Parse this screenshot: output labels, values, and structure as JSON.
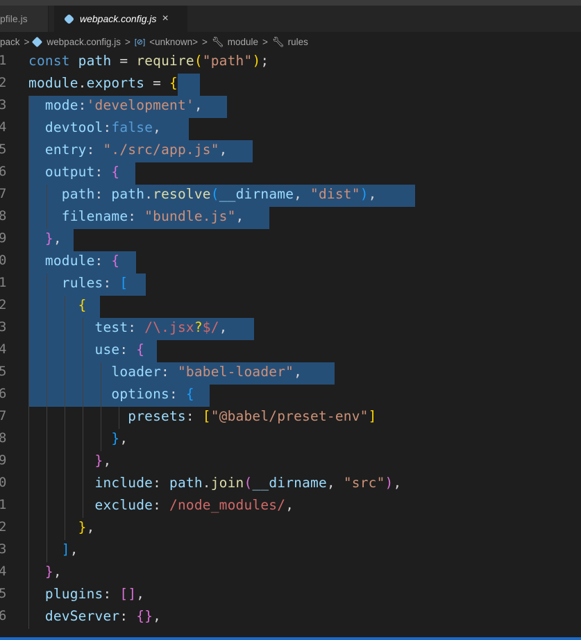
{
  "tabs": [
    {
      "label": "pfile.js",
      "active": false
    },
    {
      "label": "webpack.config.js",
      "active": true,
      "close": "×"
    }
  ],
  "breadcrumb": {
    "folder": "pack",
    "file": "webpack.config.js",
    "unknown_icon": "[⊘]",
    "unknown": "<unknown>",
    "module": "module",
    "rules": "rules",
    "sep": ">"
  },
  "editor": {
    "line_numbers": [
      "1",
      "2",
      "3",
      "4",
      "5",
      "6",
      "7",
      "8",
      "9",
      "0",
      "1",
      "2",
      "3",
      "4",
      "5",
      "6",
      "7",
      "8",
      "9",
      "0",
      "1",
      "2",
      "3",
      "4",
      "5",
      "6"
    ],
    "lines": [
      [
        [
          "kw",
          "const"
        ],
        [
          "p",
          " "
        ],
        [
          "var",
          "path"
        ],
        [
          "p",
          " = "
        ],
        [
          "fn",
          "require"
        ],
        [
          "b1",
          "("
        ],
        [
          "str",
          "\"path\""
        ],
        [
          "b1",
          ")"
        ],
        [
          "p",
          ";"
        ]
      ],
      [
        [
          "var",
          "module"
        ],
        [
          "p",
          "."
        ],
        [
          "var",
          "exports"
        ],
        [
          "p",
          " = "
        ],
        [
          "b1",
          "{"
        ]
      ],
      [
        [
          "p",
          "  "
        ],
        [
          "var",
          "mode"
        ],
        [
          "p",
          ":"
        ],
        [
          "str",
          "'development'"
        ],
        [
          "p",
          ","
        ]
      ],
      [
        [
          "p",
          "  "
        ],
        [
          "var",
          "devtool"
        ],
        [
          "p",
          ":"
        ],
        [
          "kw",
          "false"
        ],
        [
          "p",
          ","
        ]
      ],
      [
        [
          "p",
          "  "
        ],
        [
          "var",
          "entry"
        ],
        [
          "p",
          ": "
        ],
        [
          "str",
          "\"./src/app.js\""
        ],
        [
          "p",
          ","
        ]
      ],
      [
        [
          "p",
          "  "
        ],
        [
          "var",
          "output"
        ],
        [
          "p",
          ": "
        ],
        [
          "b2",
          "{"
        ]
      ],
      [
        [
          "p",
          "    "
        ],
        [
          "var",
          "path"
        ],
        [
          "p",
          ": "
        ],
        [
          "var",
          "path"
        ],
        [
          "p",
          "."
        ],
        [
          "fn",
          "resolve"
        ],
        [
          "b3",
          "("
        ],
        [
          "var",
          "__dirname"
        ],
        [
          "p",
          ", "
        ],
        [
          "str",
          "\"dist\""
        ],
        [
          "b3",
          ")"
        ],
        [
          "p",
          ","
        ]
      ],
      [
        [
          "p",
          "    "
        ],
        [
          "var",
          "filename"
        ],
        [
          "p",
          ": "
        ],
        [
          "str",
          "\"bundle.js\""
        ],
        [
          "p",
          ","
        ]
      ],
      [
        [
          "p",
          "  "
        ],
        [
          "b2",
          "}"
        ],
        [
          "p",
          ","
        ]
      ],
      [
        [
          "p",
          "  "
        ],
        [
          "var",
          "module"
        ],
        [
          "p",
          ": "
        ],
        [
          "b2",
          "{"
        ]
      ],
      [
        [
          "p",
          "    "
        ],
        [
          "var",
          "rules"
        ],
        [
          "p",
          ": "
        ],
        [
          "b3",
          "["
        ]
      ],
      [
        [
          "p",
          "      "
        ],
        [
          "b1",
          "{"
        ]
      ],
      [
        [
          "p",
          "        "
        ],
        [
          "var",
          "test"
        ],
        [
          "p",
          ": "
        ],
        [
          "re",
          "/\\.jsx"
        ],
        [
          "b1",
          "?"
        ],
        [
          "re",
          "$/"
        ],
        [
          "p",
          ","
        ]
      ],
      [
        [
          "p",
          "        "
        ],
        [
          "var",
          "use"
        ],
        [
          "p",
          ": "
        ],
        [
          "b2",
          "{"
        ]
      ],
      [
        [
          "p",
          "          "
        ],
        [
          "var",
          "loader"
        ],
        [
          "p",
          ": "
        ],
        [
          "str",
          "\"babel-loader\""
        ],
        [
          "p",
          ","
        ]
      ],
      [
        [
          "p",
          "          "
        ],
        [
          "var",
          "options"
        ],
        [
          "p",
          ": "
        ],
        [
          "b3",
          "{"
        ]
      ],
      [
        [
          "p",
          "            "
        ],
        [
          "var",
          "presets"
        ],
        [
          "p",
          ": "
        ],
        [
          "b1",
          "["
        ],
        [
          "str",
          "\"@babel/preset-env\""
        ],
        [
          "b1",
          "]"
        ]
      ],
      [
        [
          "p",
          "          "
        ],
        [
          "b3",
          "}"
        ],
        [
          "p",
          ","
        ]
      ],
      [
        [
          "p",
          "        "
        ],
        [
          "b2",
          "}"
        ],
        [
          "p",
          ","
        ]
      ],
      [
        [
          "p",
          "        "
        ],
        [
          "var",
          "include"
        ],
        [
          "p",
          ": "
        ],
        [
          "var",
          "path"
        ],
        [
          "p",
          "."
        ],
        [
          "fn",
          "join"
        ],
        [
          "b2",
          "("
        ],
        [
          "var",
          "__dirname"
        ],
        [
          "p",
          ", "
        ],
        [
          "str",
          "\"src\""
        ],
        [
          "b2",
          ")"
        ],
        [
          "p",
          ","
        ]
      ],
      [
        [
          "p",
          "        "
        ],
        [
          "var",
          "exclude"
        ],
        [
          "p",
          ": "
        ],
        [
          "re",
          "/node_modules/"
        ],
        [
          "p",
          ","
        ]
      ],
      [
        [
          "p",
          "      "
        ],
        [
          "b1",
          "}"
        ],
        [
          "p",
          ","
        ]
      ],
      [
        [
          "p",
          "    "
        ],
        [
          "b3",
          "]"
        ],
        [
          "p",
          ","
        ]
      ],
      [
        [
          "p",
          "  "
        ],
        [
          "b2",
          "}"
        ],
        [
          "p",
          ","
        ]
      ],
      [
        [
          "p",
          "  "
        ],
        [
          "var",
          "plugins"
        ],
        [
          "p",
          ": "
        ],
        [
          "b2",
          "[]"
        ],
        [
          "p",
          ","
        ]
      ],
      [
        [
          "p",
          "  "
        ],
        [
          "var",
          "devServer"
        ],
        [
          "p",
          ": "
        ],
        [
          "b2",
          "{}"
        ],
        [
          "p",
          ","
        ]
      ]
    ]
  }
}
